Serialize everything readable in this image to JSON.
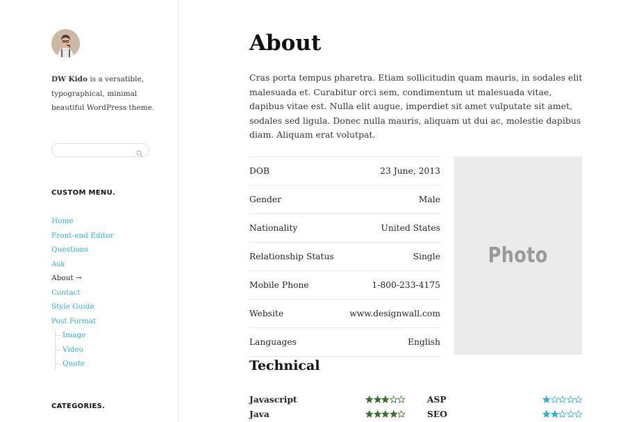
{
  "sidebar": {
    "site_name": "DW Kido",
    "tagline_line1": "is a versatible,",
    "tagline_line2": "typographical, minimal",
    "tagline_line3": "beautiful WordPress theme.",
    "search": {
      "placeholder": "",
      "icon": "search-icon"
    },
    "menu_title": "CUSTOM MENU.",
    "menu": [
      {
        "label": "Home"
      },
      {
        "label": "Front-end Editor"
      },
      {
        "label": "Questions"
      },
      {
        "label": "Ask"
      },
      {
        "label": "About →",
        "current": true
      },
      {
        "label": "Contact"
      },
      {
        "label": "Style Guide"
      },
      {
        "label": "Post Format"
      }
    ],
    "submenu": [
      {
        "label": "Image"
      },
      {
        "label": "Video"
      },
      {
        "label": "Quote"
      }
    ],
    "categories_title": "CATEGORIES."
  },
  "main": {
    "title": "About",
    "lead": "Cras porta tempus pharetra. Etiam sollicitudin quam mauris, in sodales elit malesuada et. Curabitur orci sem, condimentum ut malesuada vitae, dapibus vitae est. Nulla elit augue, imperdiet sit amet vulputate sit amet, sodales sed ligula. Donec nulla mauris, aliquam ut dui ac, molestie dapibus diam. Aliquam erat volutpat.",
    "info": [
      {
        "label": "DOB",
        "value": "23 June, 2013"
      },
      {
        "label": "Gender",
        "value": "Male"
      },
      {
        "label": "Nationality",
        "value": "United States"
      },
      {
        "label": "Relationship Status",
        "value": "Single"
      },
      {
        "label": "Mobile Phone",
        "value": "1-800-233-4175"
      },
      {
        "label": "Website",
        "value": "www.designwall.com"
      },
      {
        "label": "Languages",
        "value": "English"
      }
    ],
    "photo_label": "Photo",
    "technical_title": "Technical",
    "skills": [
      {
        "name": "Javascript",
        "rating": 3,
        "max": 5,
        "color": "#3c6e2e"
      },
      {
        "name": "Java",
        "rating": 4,
        "max": 5,
        "color": "#3c6e2e"
      },
      {
        "name": "ASP",
        "rating": 1,
        "max": 5,
        "color": "#2bb3d6"
      },
      {
        "name": "SEO",
        "rating": 2,
        "max": 5,
        "color": "#2bb3d6"
      }
    ]
  },
  "colors": {
    "link": "#2bb3d6",
    "star_green": "#3c6e2e",
    "star_blue": "#2bb3d6"
  }
}
